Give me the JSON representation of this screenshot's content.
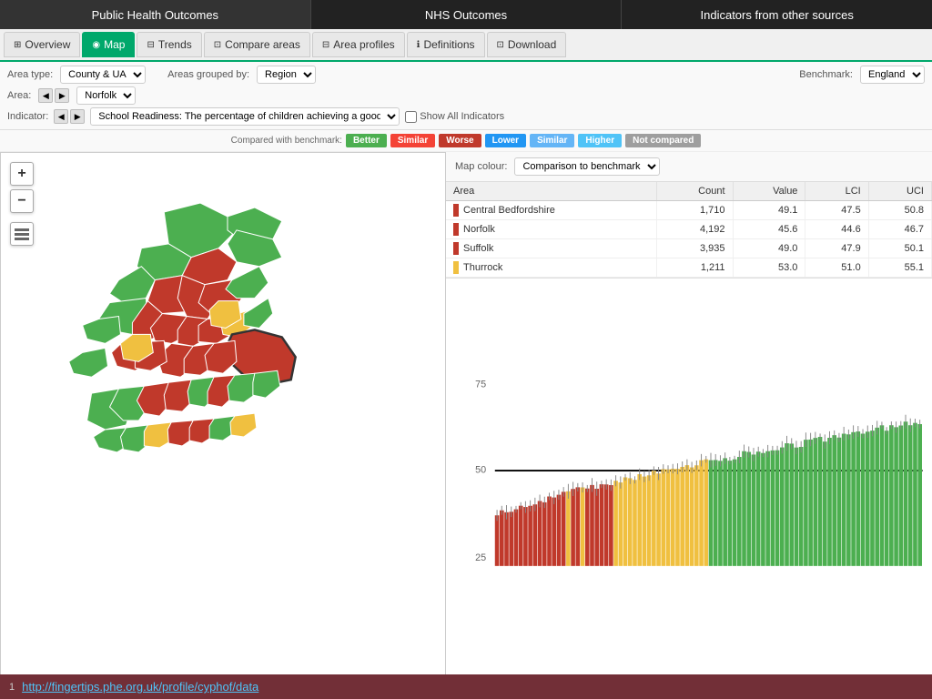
{
  "topNav": {
    "items": [
      {
        "label": "Public Health Outcomes",
        "active": true
      },
      {
        "label": "NHS Outcomes",
        "active": false
      },
      {
        "label": "Indicators from other sources",
        "active": false
      }
    ]
  },
  "tabs": [
    {
      "label": "Overview",
      "icon": "⊞",
      "active": false
    },
    {
      "label": "Map",
      "icon": "◉",
      "active": true
    },
    {
      "label": "Trends",
      "icon": "⊟",
      "active": false
    },
    {
      "label": "Compare areas",
      "icon": "⊡",
      "active": false
    },
    {
      "label": "Area profiles",
      "icon": "⊟",
      "active": false
    },
    {
      "label": "Definitions",
      "icon": "ℹ",
      "active": false
    },
    {
      "label": "Download",
      "icon": "⊡",
      "active": false
    }
  ],
  "controls": {
    "areaTypeLabel": "Area type:",
    "areaTypeValue": "County & UA",
    "areasGroupedByLabel": "Areas grouped by:",
    "areasGroupedByValue": "Region",
    "areaLabel": "Area:",
    "areaValue": "Norfolk",
    "benchmarkLabel": "Benchmark:",
    "benchmarkValue": "England",
    "indicatorLabel": "Indicator:",
    "indicatorValue": "School Readiness: The percentage of children achieving a good",
    "showAllIndicators": "Show All Indicators"
  },
  "legend": {
    "comparedWith": "Compared with benchmark:",
    "items": [
      {
        "label": "Better",
        "class": "badge-better"
      },
      {
        "label": "Similar",
        "class": "badge-similar-red"
      },
      {
        "label": "Worse",
        "class": "badge-worse"
      },
      {
        "label": "Lower",
        "class": "badge-lower"
      },
      {
        "label": "Similar",
        "class": "badge-similar-blue"
      },
      {
        "label": "Higher",
        "class": "badge-higher"
      },
      {
        "label": "Not compared",
        "class": "badge-not-compared"
      }
    ]
  },
  "mapColour": {
    "label": "Map colour:",
    "value": "Comparison to benchmark"
  },
  "table": {
    "headers": [
      "Area",
      "Count",
      "Value",
      "LCI",
      "UCI"
    ],
    "rows": [
      {
        "area": "Central Bedfordshire",
        "color": "#c0392b",
        "count": "1,710",
        "value": "49.1",
        "lci": "47.5",
        "uci": "50.8"
      },
      {
        "area": "Norfolk",
        "color": "#c0392b",
        "count": "4,192",
        "value": "45.6",
        "lci": "44.6",
        "uci": "46.7"
      },
      {
        "area": "Suffolk",
        "color": "#c0392b",
        "count": "3,935",
        "value": "49.0",
        "lci": "47.9",
        "uci": "50.1"
      },
      {
        "area": "Thurrock",
        "color": "#f0c040",
        "count": "1,211",
        "value": "53.0",
        "lci": "51.0",
        "uci": "55.1"
      }
    ]
  },
  "chart": {
    "yLabels": [
      "75",
      "50",
      "25"
    ],
    "benchmarkLine": 50
  },
  "urlBar": {
    "number": "1",
    "url": "http://fingertips.phe.org.uk/profile/cyphof/data"
  },
  "mapZoom": {
    "plusLabel": "+",
    "minusLabel": "−"
  }
}
